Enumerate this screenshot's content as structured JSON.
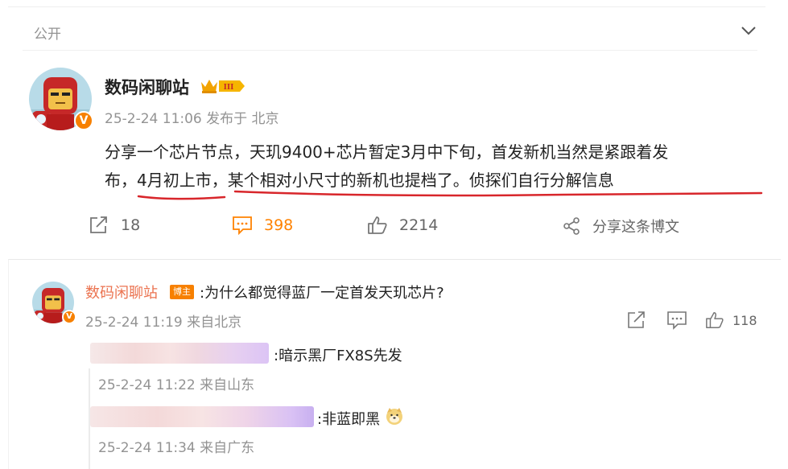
{
  "visibility": {
    "label": "公开"
  },
  "post": {
    "author": "数码闲聊站",
    "vip_level": "III",
    "timestamp": "25-2-24 11:06",
    "location": "发布于 北京",
    "text_line1": "分享一个芯片节点，天玑9400+芯片暂定3月中下旬，首发新机当然是紧跟着发",
    "text_line2": "布，4月初上市，某个相对小尺寸的新机也提档了。侦探们自行分解信息",
    "actions": {
      "share_count": "18",
      "comment_count": "398",
      "like_count": "2214",
      "forward_label": "分享这条博文"
    }
  },
  "comment": {
    "author": "数码闲聊站",
    "badge": "博主",
    "text": ":为什么都觉得蓝厂一定首发天玑芯片?",
    "meta": "25-2-24 11:19 来自北京",
    "like_count": "118"
  },
  "replies": [
    {
      "text": ":暗示黑厂FX8S先发",
      "meta": "25-2-24 11:22 来自山东"
    },
    {
      "text": ":非蓝即黑",
      "meta": "25-2-24 11:34 来自广东"
    }
  ],
  "colors": {
    "accent_orange": "#ff8200",
    "name_orange": "#eb7350",
    "verified_badge": "#f78000",
    "annotation_red": "#d8262b"
  }
}
